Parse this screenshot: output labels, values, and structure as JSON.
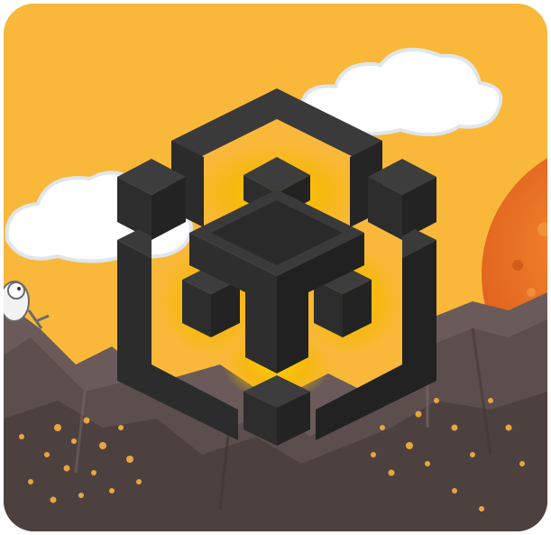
{
  "icon": {
    "subject": "mining-game-app-icon",
    "colors": {
      "sky": "#f9b83a",
      "cloud": "#ffffff",
      "cloud_shade": "#dfe6ec",
      "sun": "#e8681f",
      "sun_highlight": "#f58a2d",
      "mountain": "#5f5150",
      "mountain_dark": "#4a3e3d",
      "mountain_light": "#7a6b69",
      "gold": "#e8a542",
      "cube_dark": "#262626",
      "cube_mid": "#333333",
      "cube_top": "#3d3d3d",
      "glow": "#f5c400"
    },
    "elements": [
      "cloud-icon",
      "sun-icon",
      "mountain-icon",
      "gold-nugget-icon",
      "miner-character-icon",
      "cube-logo-icon"
    ]
  }
}
